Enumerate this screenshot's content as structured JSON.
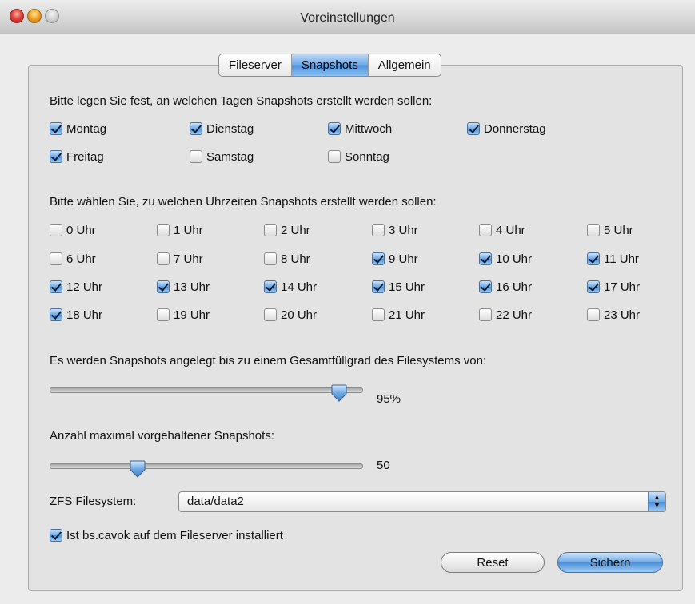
{
  "window": {
    "title": "Voreinstellungen"
  },
  "tabs": [
    {
      "label": "Fileserver",
      "active": false
    },
    {
      "label": "Snapshots",
      "active": true
    },
    {
      "label": "Allgemein",
      "active": false
    }
  ],
  "days": {
    "label": "Bitte legen Sie fest, an welchen Tagen Snapshots erstellt werden sollen:",
    "items": [
      {
        "label": "Montag",
        "checked": true
      },
      {
        "label": "Dienstag",
        "checked": true
      },
      {
        "label": "Mittwoch",
        "checked": true
      },
      {
        "label": "Donnerstag",
        "checked": true
      },
      {
        "label": "Freitag",
        "checked": true
      },
      {
        "label": "Samstag",
        "checked": false
      },
      {
        "label": "Sonntag",
        "checked": false
      }
    ]
  },
  "hours": {
    "label": "Bitte wählen Sie, zu welchen Uhrzeiten Snapshots erstellt werden sollen:",
    "items": [
      {
        "label": "0 Uhr",
        "checked": false
      },
      {
        "label": "1 Uhr",
        "checked": false
      },
      {
        "label": "2 Uhr",
        "checked": false
      },
      {
        "label": "3 Uhr",
        "checked": false
      },
      {
        "label": "4 Uhr",
        "checked": false
      },
      {
        "label": "5 Uhr",
        "checked": false
      },
      {
        "label": "6 Uhr",
        "checked": false
      },
      {
        "label": "7 Uhr",
        "checked": false
      },
      {
        "label": "8 Uhr",
        "checked": false
      },
      {
        "label": "9 Uhr",
        "checked": true
      },
      {
        "label": "10 Uhr",
        "checked": true
      },
      {
        "label": "11 Uhr",
        "checked": true
      },
      {
        "label": "12 Uhr",
        "checked": true
      },
      {
        "label": "13 Uhr",
        "checked": true
      },
      {
        "label": "14 Uhr",
        "checked": true
      },
      {
        "label": "15 Uhr",
        "checked": true
      },
      {
        "label": "16 Uhr",
        "checked": true
      },
      {
        "label": "17 Uhr",
        "checked": true
      },
      {
        "label": "18 Uhr",
        "checked": true
      },
      {
        "label": "19 Uhr",
        "checked": false
      },
      {
        "label": "20 Uhr",
        "checked": false
      },
      {
        "label": "21 Uhr",
        "checked": false
      },
      {
        "label": "22 Uhr",
        "checked": false
      },
      {
        "label": "23 Uhr",
        "checked": false
      }
    ]
  },
  "fill_slider": {
    "label": "Es werden Snapshots angelegt bis zu einem Gesamtfüllgrad des Filesystems von:",
    "value_text": "95%",
    "level": 0.95
  },
  "count_slider": {
    "label": "Anzahl maximal vorgehaltener Snapshots:",
    "value_text": "50",
    "level": 0.27
  },
  "zfs": {
    "label": "ZFS Filesystem:",
    "selected": "data/data2"
  },
  "bscavok": {
    "label": "Ist bs.cavok auf dem Fileserver installiert",
    "checked": true
  },
  "buttons": {
    "reset": "Reset",
    "save": "Sichern"
  },
  "colors": {
    "accent": "#4b8fd8",
    "window_bg": "#ececec"
  }
}
